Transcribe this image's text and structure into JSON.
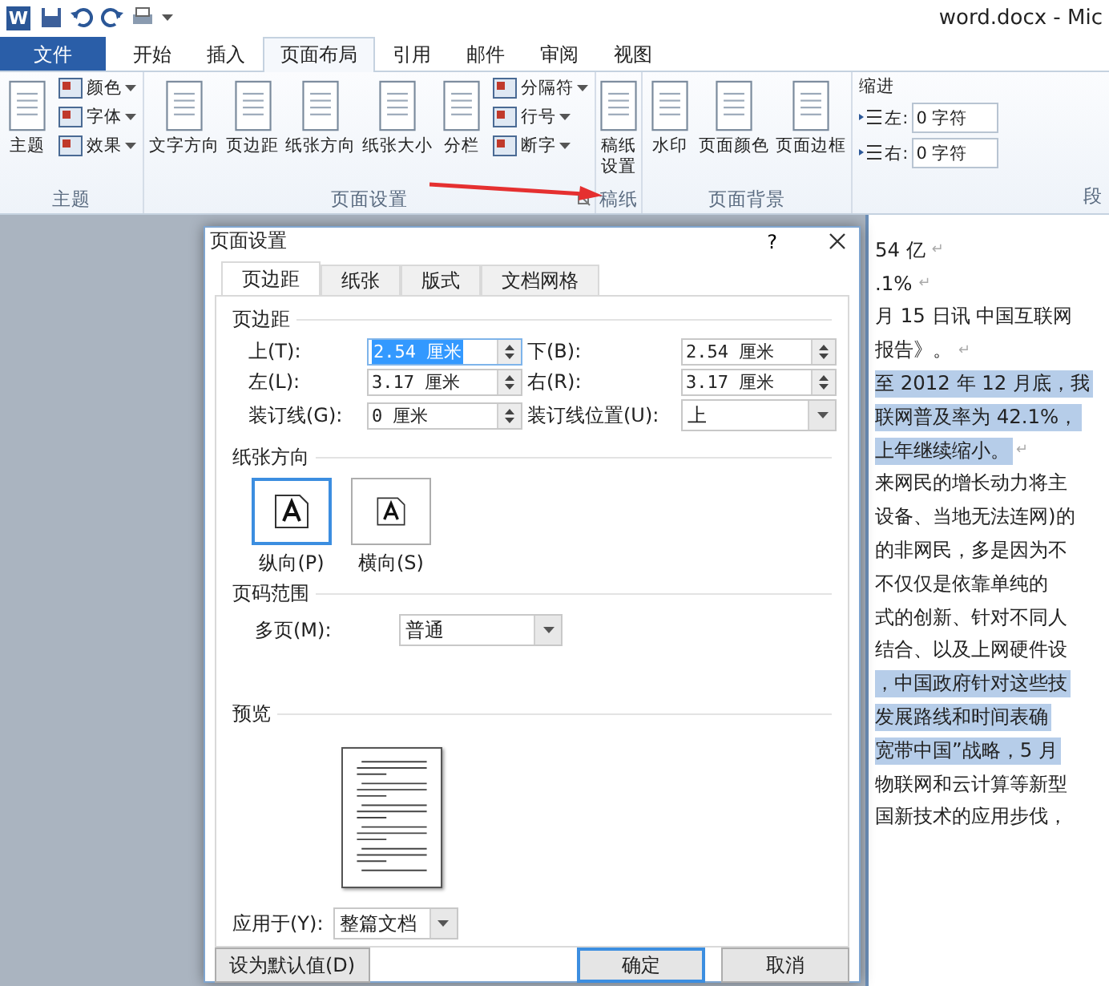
{
  "title_bar": {
    "logo": "W",
    "title": "word.docx - Mic"
  },
  "tabs": [
    {
      "label": "文件",
      "kind": "file",
      "selected": false
    },
    {
      "label": "开始",
      "kind": "tab",
      "selected": false
    },
    {
      "label": "插入",
      "kind": "tab",
      "selected": false
    },
    {
      "label": "页面布局",
      "kind": "tab",
      "selected": true
    },
    {
      "label": "引用",
      "kind": "tab",
      "selected": false
    },
    {
      "label": "邮件",
      "kind": "tab",
      "selected": false
    },
    {
      "label": "审阅",
      "kind": "tab",
      "selected": false
    },
    {
      "label": "视图",
      "kind": "tab",
      "selected": false
    }
  ],
  "ribbon_groups": [
    {
      "label": "主题",
      "launcher": false,
      "items": [
        {
          "kind": "large",
          "label": "主题"
        },
        {
          "kind": "small",
          "label": "颜色"
        },
        {
          "kind": "small",
          "label": "字体"
        },
        {
          "kind": "small",
          "label": "效果"
        }
      ]
    },
    {
      "label": "页面设置",
      "launcher": true,
      "items": [
        {
          "kind": "large",
          "label": "文字方向"
        },
        {
          "kind": "large",
          "label": "页边距"
        },
        {
          "kind": "large",
          "label": "纸张方向"
        },
        {
          "kind": "large",
          "label": "纸张大小"
        },
        {
          "kind": "large",
          "label": "分栏"
        },
        {
          "kind": "small",
          "label": "分隔符"
        },
        {
          "kind": "small",
          "label": "行号"
        },
        {
          "kind": "small",
          "label": "断字"
        }
      ]
    },
    {
      "label": "稿纸",
      "launcher": false,
      "items": [
        {
          "kind": "large",
          "label": "稿纸设置"
        }
      ]
    },
    {
      "label": "页面背景",
      "launcher": false,
      "items": [
        {
          "kind": "large",
          "label": "水印"
        },
        {
          "kind": "large",
          "label": "页面颜色"
        },
        {
          "kind": "large",
          "label": "页面边框"
        }
      ]
    }
  ],
  "paragraph_group": {
    "label": "段",
    "indent_title": "缩进",
    "fields": [
      {
        "label": "左:",
        "value": "0 字符"
      },
      {
        "label": "右:",
        "value": "0 字符"
      }
    ]
  },
  "document_lines": [
    {
      "text": "54 亿",
      "end_mark": "↵",
      "selected": false
    },
    {
      "text": ".1%",
      "end_mark": "↵",
      "selected": false
    },
    {
      "text": "月 15 日讯  中国互联网",
      "selected": false
    },
    {
      "text": "报告》。",
      "end_mark": "↵",
      "selected": false
    },
    {
      "text": "至 2012 年 12 月底，我",
      "selected": true
    },
    {
      "text": "联网普及率为 42.1%，",
      "selected": true
    },
    {
      "text": "上年继续缩小。",
      "end_mark": "↵",
      "selected": true
    },
    {
      "text": "来网民的增长动力将主",
      "selected": false
    },
    {
      "text": "设备、当地无法连网)的",
      "selected": false
    },
    {
      "text": "的非网民，多是因为不",
      "selected": false
    },
    {
      "text": "不仅仅是依靠单纯的",
      "selected": false
    },
    {
      "text": "式的创新、针对不同人",
      "selected": false
    },
    {
      "text": "结合、以及上网硬件设",
      "selected": false
    },
    {
      "text": "，中国政府针对这些技",
      "selected": true
    },
    {
      "text": "发展路线和时间表确",
      "selected": true
    },
    {
      "text": "宽带中国”战略，5 月",
      "selected": true
    },
    {
      "text": "物联网和云计算等新型",
      "selected": false
    },
    {
      "text": "国新技术的应用步伐，",
      "selected": false
    }
  ],
  "dialog": {
    "title": "页面设置",
    "help": "?",
    "tabs": [
      {
        "label": "页边距",
        "selected": true
      },
      {
        "label": "纸张",
        "selected": false
      },
      {
        "label": "版式",
        "selected": false
      },
      {
        "label": "文档网格",
        "selected": false
      }
    ],
    "margins": {
      "heading": "页边距",
      "fields": [
        {
          "label": "上(T):",
          "value": "2.54 厘米",
          "kind": "spin",
          "selected": true
        },
        {
          "label": "下(B):",
          "value": "2.54 厘米",
          "kind": "spin",
          "selected": false
        },
        {
          "label": "左(L):",
          "value": "3.17 厘米",
          "kind": "spin",
          "selected": false
        },
        {
          "label": "右(R):",
          "value": "3.17 厘米",
          "kind": "spin",
          "selected": false
        },
        {
          "label": "装订线(G):",
          "value": "0 厘米",
          "kind": "spin",
          "selected": false
        },
        {
          "label": "装订线位置(U):",
          "value": "上",
          "kind": "dropdown"
        }
      ]
    },
    "orientation": {
      "heading": "纸张方向",
      "options": [
        {
          "label": "纵向(P)",
          "selected": true
        },
        {
          "label": "横向(S)",
          "selected": false
        }
      ]
    },
    "pages": {
      "heading": "页码范围",
      "label": "多页(M):",
      "value": "普通"
    },
    "preview": {
      "heading": "预览"
    },
    "apply": {
      "label": "应用于(Y):",
      "value": "整篇文档"
    },
    "buttons": [
      {
        "label": "设为默认值(D)",
        "kind": "left",
        "default": false
      },
      {
        "label": "确定",
        "kind": "right",
        "default": true
      },
      {
        "label": "取消",
        "kind": "right",
        "default": false
      }
    ]
  }
}
